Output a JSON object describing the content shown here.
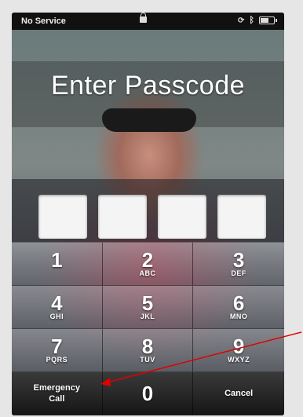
{
  "status_bar": {
    "carrier": "No Service"
  },
  "title": "Enter Passcode",
  "passcode_fields": 4,
  "keypad": {
    "keys": [
      {
        "digit": "1",
        "letters": ""
      },
      {
        "digit": "2",
        "letters": "ABC"
      },
      {
        "digit": "3",
        "letters": "DEF"
      },
      {
        "digit": "4",
        "letters": "GHI"
      },
      {
        "digit": "5",
        "letters": "JKL"
      },
      {
        "digit": "6",
        "letters": "MNO"
      },
      {
        "digit": "7",
        "letters": "PQRS"
      },
      {
        "digit": "8",
        "letters": "TUV"
      },
      {
        "digit": "9",
        "letters": "WXYZ"
      }
    ],
    "emergency_line1": "Emergency",
    "emergency_line2": "Call",
    "zero": "0",
    "cancel": "Cancel"
  },
  "colors": {
    "annotation_arrow": "#e00000",
    "key_text": "#ffffff"
  }
}
